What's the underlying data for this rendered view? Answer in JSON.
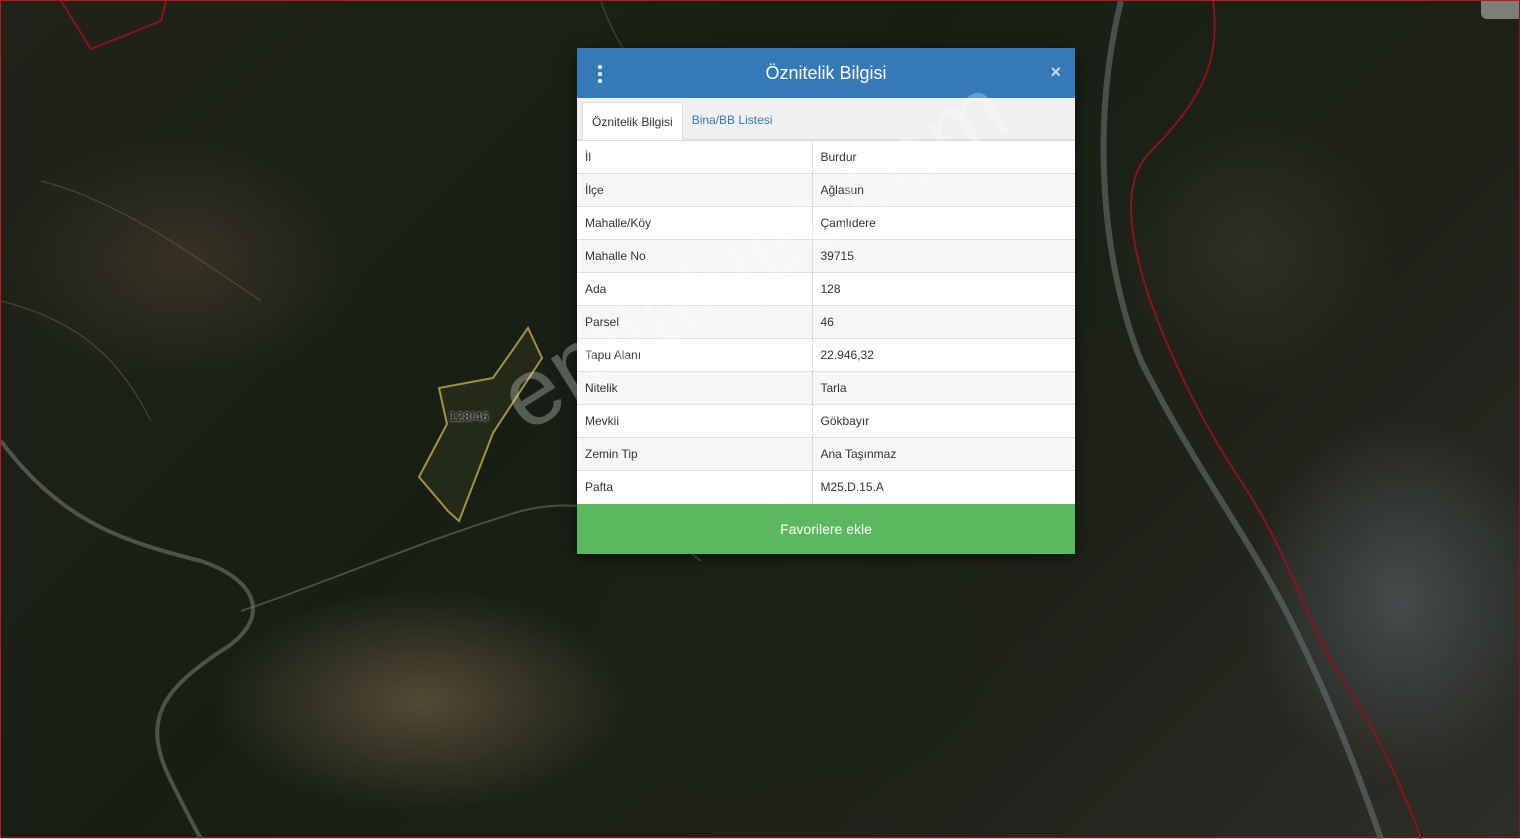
{
  "map": {
    "parcel_label": "128/46",
    "watermark": "emlakjet.com",
    "colors": {
      "boundary": "#c0171f",
      "parcel_outline": "#d8c25a"
    }
  },
  "dialog": {
    "title": "Öznitelik Bilgisi",
    "close_label": "×",
    "tabs": [
      {
        "label": "Öznitelik Bilgisi",
        "active": true
      },
      {
        "label": "Bina/BB Listesi",
        "active": false
      }
    ],
    "rows": [
      {
        "key": "İl",
        "value": "Burdur"
      },
      {
        "key": "İlçe",
        "value": "Ağlasun"
      },
      {
        "key": "Mahalle/Köy",
        "value": "Çamlıdere"
      },
      {
        "key": "Mahalle No",
        "value": "39715"
      },
      {
        "key": "Ada",
        "value": "128"
      },
      {
        "key": "Parsel",
        "value": "46"
      },
      {
        "key": "Tapu Alanı",
        "value": "22.946,32"
      },
      {
        "key": "Nitelik",
        "value": "Tarla"
      },
      {
        "key": "Mevkii",
        "value": "Gökbayır"
      },
      {
        "key": "Zemin Tip",
        "value": "Ana Taşınmaz"
      },
      {
        "key": "Pafta",
        "value": "M25.D.15.A"
      }
    ],
    "favorite_button": "Favorilere ekle",
    "colors": {
      "header": "#337ab7",
      "button": "#5cb85c"
    }
  }
}
